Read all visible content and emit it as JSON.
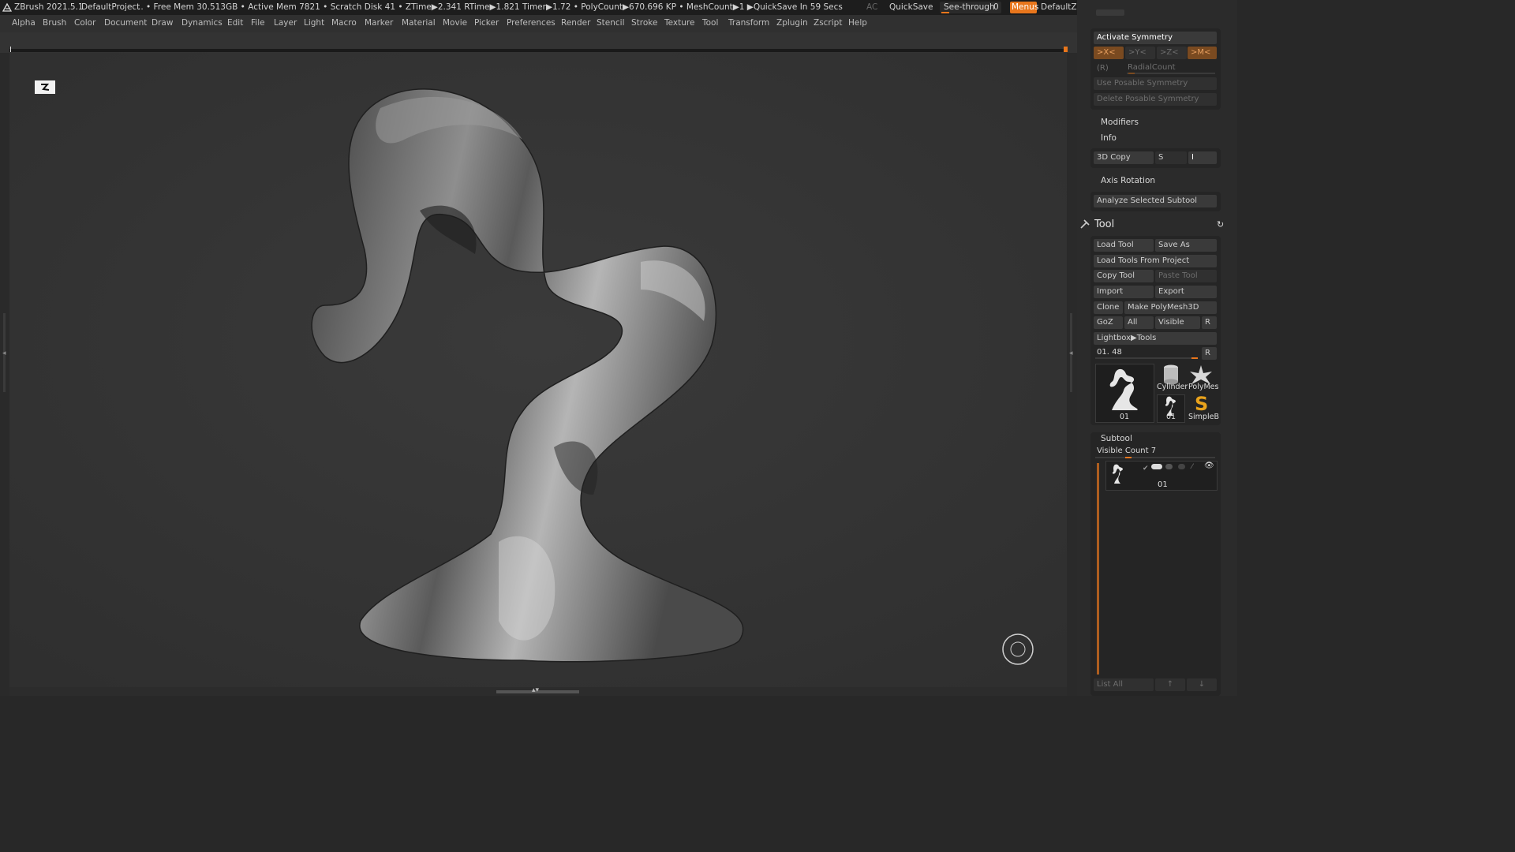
{
  "titlebar": {
    "app": "ZBrush 2021.5.1",
    "project": "DefaultProject",
    "stats": ".. • Free Mem 30.513GB • Active Mem 7821 • Scratch Disk 41 •  ZTime▶2.341 RTime▶1.821 Timer▶1.72 • PolyCount▶670.696 KP  • MeshCount▶1  ▶QuickSave In 59 Secs",
    "ac": "AC",
    "quicksave": "QuickSave",
    "seethrough": "See-through",
    "seethrough_value": "0",
    "menus": "Menus",
    "zscript": "DefaultZScript"
  },
  "menu": [
    "Alpha",
    "Brush",
    "Color",
    "Document",
    "Draw",
    "Dynamics",
    "Edit",
    "File",
    "Layer",
    "Light",
    "Macro",
    "Marker",
    "Material",
    "Movie",
    "Picker",
    "Preferences",
    "Render",
    "Stencil",
    "Stroke",
    "Texture",
    "Tool",
    "Transform",
    "Zplugin",
    "Zscript",
    "Help"
  ],
  "symmetry": {
    "activate": "Activate Symmetry",
    "x": ">X<",
    "y": ">Y<",
    "z": ">Z<",
    "m": ">M<",
    "r": "(R)",
    "radial": "RadialCount",
    "use_posable": "Use Posable Symmetry",
    "delete_posable": "Delete Posable Symmetry"
  },
  "sections": {
    "modifiers": "Modifiers",
    "info": "Info",
    "copy3d": "3D Copy",
    "s": "S",
    "i": "I",
    "axis_rotation": "Axis Rotation",
    "analyze": "Analyze Selected Subtool"
  },
  "tool": {
    "title": "Tool",
    "load_tool": "Load Tool",
    "save_as": "Save As",
    "load_from_project": "Load Tools From Project",
    "copy_tool": "Copy Tool",
    "paste_tool": "Paste Tool",
    "import": "Import",
    "export": "Export",
    "clone": "Clone",
    "make_polymesh": "Make PolyMesh3D",
    "goz": "GoZ",
    "all": "All",
    "visible": "Visible",
    "r": "R",
    "lightbox": "Lightbox▶Tools",
    "current": "01. 48",
    "r2": "R",
    "thumbs": {
      "main": "01",
      "cylinder": "Cylinder",
      "polymesh": "PolyMes",
      "small": "01",
      "simpleb": "SimpleB"
    }
  },
  "subtool": {
    "title": "Subtool",
    "visible_count": "Visible Count 7",
    "item_label": "01",
    "list_all": "List All"
  },
  "colors": {
    "accent": "#e8761c",
    "panel": "#2b2b2b",
    "canvas": "#353535"
  }
}
